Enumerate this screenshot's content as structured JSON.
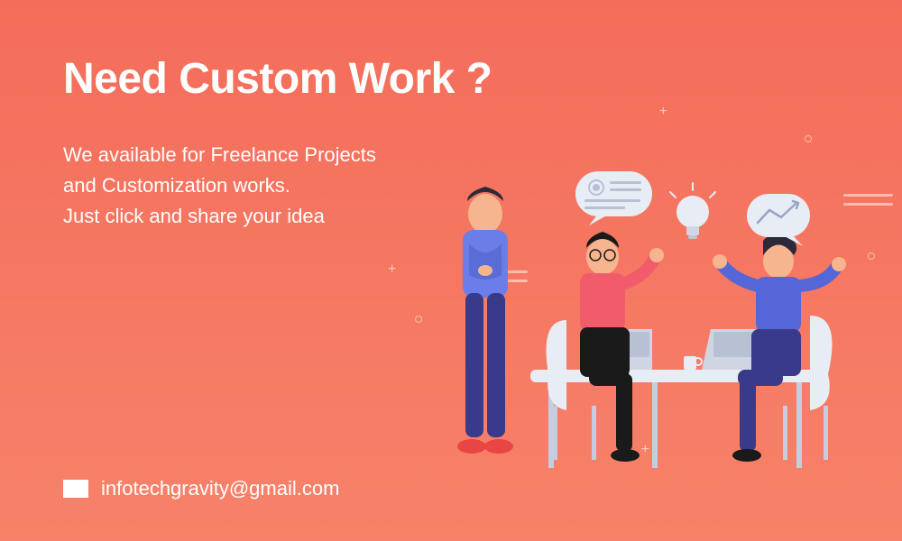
{
  "hero": {
    "headline": "Need Custom Work ?",
    "line1": "We available for Freelance Projects",
    "line2": "and Customization works.",
    "line3": "Just click and share your idea"
  },
  "contact": {
    "email": "infotechgravity@gmail.com"
  }
}
